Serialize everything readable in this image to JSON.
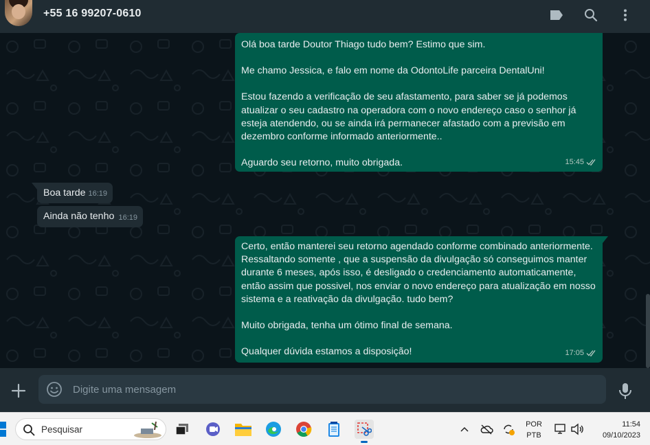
{
  "header": {
    "contact_name": "+55 16 99207-0610",
    "avatar_icon": "contact-photo",
    "labels_icon": "label-icon",
    "search_icon": "search-icon",
    "menu_icon": "kebab-menu-icon"
  },
  "messages": [
    {
      "direction": "out",
      "paragraphs": [
        "Olá boa tarde Doutor Thiago tudo bem? Estimo que sim.",
        "Me chamo Jessica, e falo em nome da OdontoLife parceira DentalUni!",
        "Estou fazendo a verificação de seu afastamento, para saber se já podemos atualizar o seu cadastro na operadora com o novo endereço caso o senhor já esteja atendendo, ou se ainda irá permanecer afastado com a previsão em dezembro conforme informado anteriormente..",
        "Aguardo seu retorno, muito obrigada."
      ],
      "time": "15:45",
      "status": "read"
    },
    {
      "direction": "in",
      "text": "Boa tarde",
      "time": "16:19"
    },
    {
      "direction": "in",
      "text": "Ainda não tenho",
      "time": "16:19"
    },
    {
      "direction": "out",
      "paragraphs": [
        "Certo, então manterei seu retorno agendado conforme combinado anteriormente. Ressaltando somente , que a suspensão da divulgação só conseguimos manter durante 6 meses, após isso, é desligado o credenciamento automaticamente, então assim que possivel, nos enviar o novo endereço para atualização em nosso sistema e a reativação da divulgação. tudo bem?",
        "Muito obrigada, tenha um ótimo final de semana.",
        "Qualquer dúvida estamos a disposição!"
      ],
      "time": "17:05",
      "status": "read"
    }
  ],
  "composer": {
    "placeholder": "Digite uma mensagem",
    "attach_icon": "plus-icon",
    "emoji_icon": "emoji-icon",
    "mic_icon": "microphone-icon"
  },
  "taskbar": {
    "search_placeholder": "Pesquisar",
    "apps": [
      "task-view-icon",
      "teams-chat-icon",
      "file-explorer-icon",
      "edge-icon",
      "chrome-icon",
      "notepad-icon",
      "snipping-tool-icon"
    ],
    "language_line1": "POR",
    "language_line2": "PTB",
    "time": "11:54",
    "date": "09/10/2023"
  },
  "colors": {
    "header_bg": "#202c33",
    "chat_bg": "#0b141a",
    "outgoing_bubble": "#005c4b",
    "incoming_bubble": "#202c33",
    "read_ticks": "#b5c9c2"
  }
}
